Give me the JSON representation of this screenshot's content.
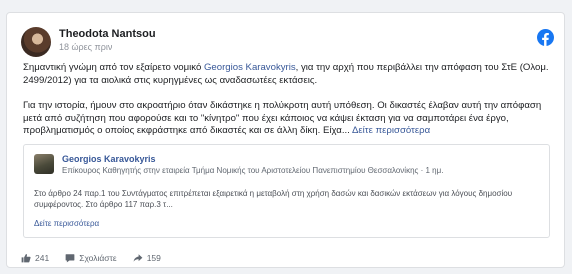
{
  "post": {
    "author": "Theodota Nantsou",
    "time": "18 ώρες πριν",
    "text1_a": "Σημαντική γνώμη από τον εξαίρετο νομικό ",
    "text1_link": "Georgios Karavokyris",
    "text1_b": ", για την αρχή που περιβάλλει την απόφαση του ΣτΕ (Ολομ. 2499/2012) για τα αιολικά στις κυρηγμένες ως αναδασωτέες εκτάσεις.",
    "text2": "Για την ιστορία, ήμουν στο ακροατήριο όταν δικάστηκε η πολύκροτη αυτή υπόθεση. Οι δικαστές έλαβαν αυτή την απόφαση μετά από συζήτηση που αφορούσε και το \"κίνητρο\" που έχει κάποιος να κάψει έκταση για να σαμποτάρει ένα έργο, προβληματισμός ο οποίος εκφράστηκε από δικαστές και σε άλλη δίκη. Είχα...",
    "see_more": "Δείτε περισσότερα"
  },
  "quoted": {
    "name": "Georgios Karavokyris",
    "subtitle": "Επίκουρος Καθηγητής στην εταιρεία Τμήμα Νομικής του Αριστοτελείου Πανεπιστημίου Θεσσαλονίκης · 1 ημ.",
    "text": "Στο άρθρο 24 παρ.1 του Συντάγματος επιτρέπεται εξαιρετικά η μεταβολή στη χρήση δασών και δασικών εκτάσεων για λόγους δημοσίου συμφέροντος. Στο άρθρο 117 παρ.3 τ...",
    "see_more": "Δείτε περισσότερα"
  },
  "actions": {
    "likes": "241",
    "comment_label": "Σχολιάστε",
    "shares": "159"
  },
  "icons": {
    "brand": "facebook-icon",
    "like": "thumbs-up-icon",
    "comment": "comment-icon",
    "share": "share-icon"
  },
  "colors": {
    "facebook_blue": "#1877f2",
    "link": "#385898"
  }
}
